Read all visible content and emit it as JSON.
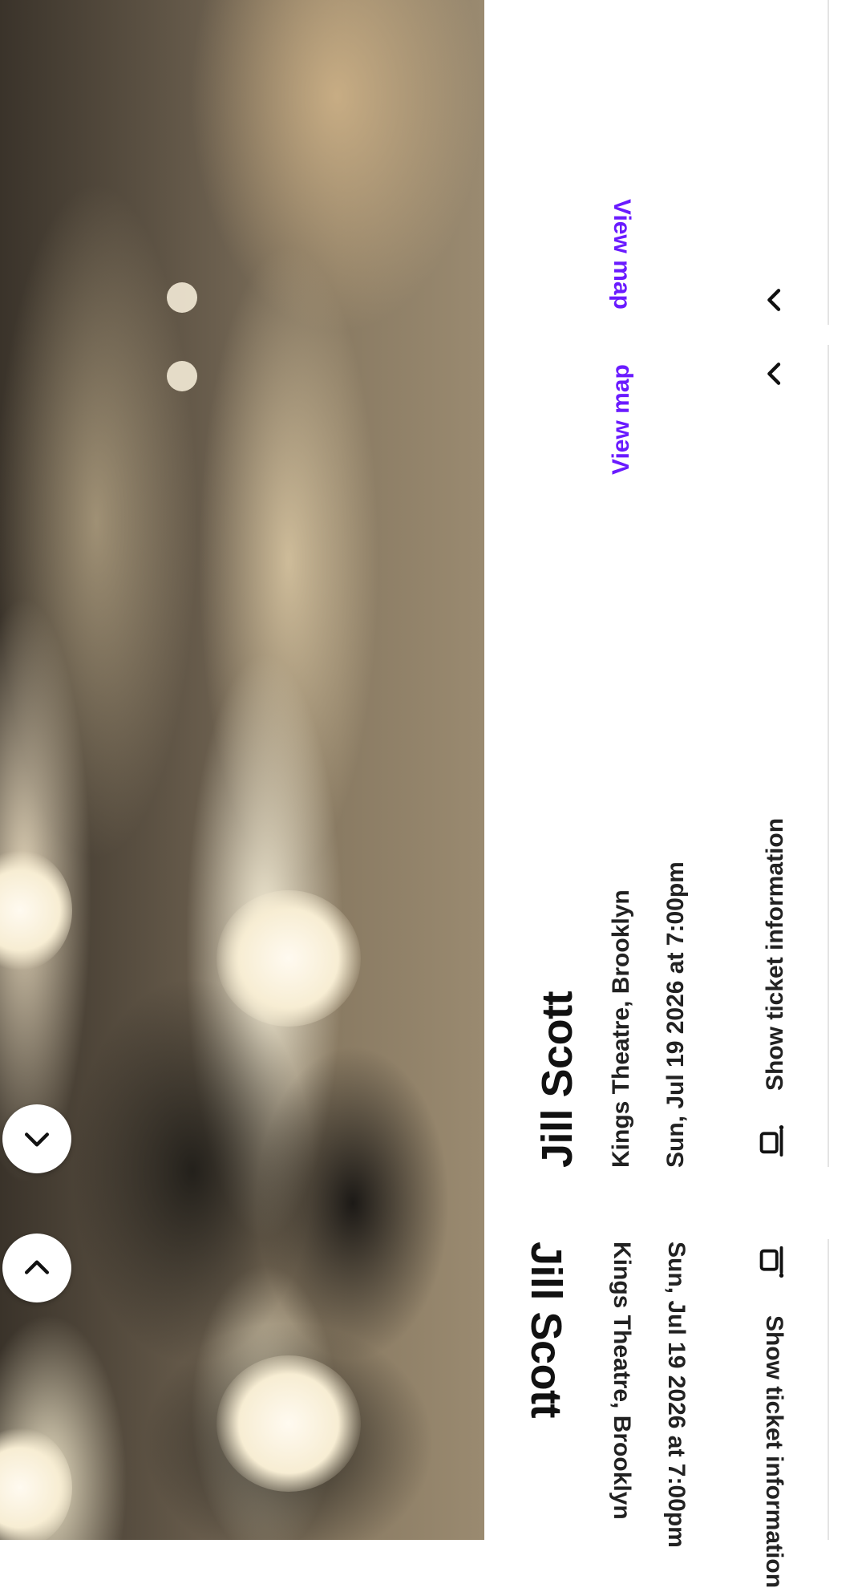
{
  "event": {
    "title": "Jill Scott",
    "venue": "Kings Theatre, Brooklyn",
    "datetime": "Sun, Jul 19 2026 at 7:00pm",
    "view_map_label": "View map",
    "ticket_info_label": "Show ticket information"
  },
  "mirror": {
    "title": "Jill Scott",
    "venue": "Kings Theatre, Brooklyn",
    "datetime": "Sun, Jul 19 2026 at 7:00pm",
    "view_map_label": "View map",
    "ticket_info_label": "Show ticket information"
  },
  "controls": {
    "scroll_down_icon": "chevron-down-icon",
    "scroll_up_icon": "chevron-up-icon"
  },
  "colors": {
    "link": "#6a1bff",
    "text": "#111111"
  }
}
